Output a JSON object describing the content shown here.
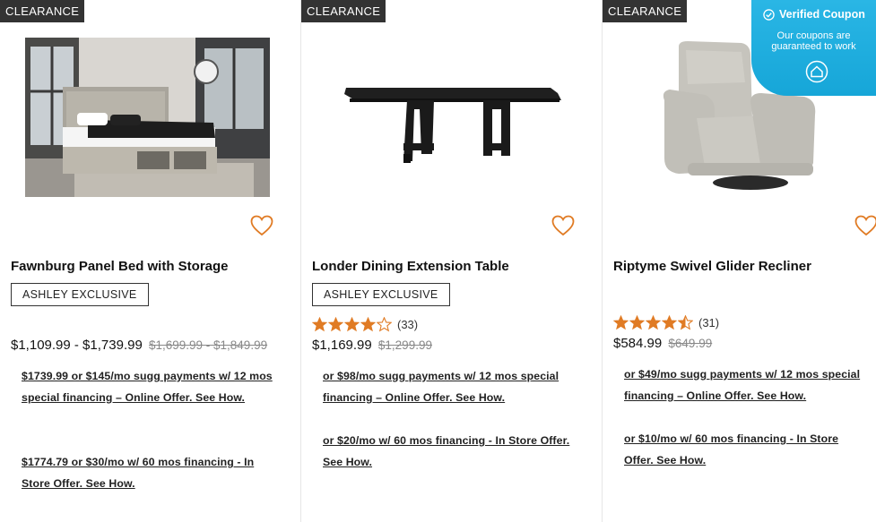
{
  "products": [
    {
      "badge": "CLEARANCE",
      "name": "Fawnburg Panel Bed with Storage",
      "exclusive": "ASHLEY EXCLUSIVE",
      "price_range": "$1,109.99 - $1,739.99",
      "was_price": "$1,699.99 - $1,849.99",
      "fin1": "$1739.99 or $145/mo sugg payments w/ 12 mos special financing – Online Offer. See How.",
      "fin2": "$1774.79 or $30/mo w/ 60 mos financing - In Store Offer. See How."
    },
    {
      "badge": "CLEARANCE",
      "name": "Londer Dining Extension Table",
      "exclusive": "ASHLEY EXCLUSIVE",
      "rating": 4,
      "rating_count": "(33)",
      "price": "$1,169.99",
      "was_price": "$1,299.99",
      "fin1": "or $98/mo sugg payments w/ 12 mos special financing – Online Offer. See How.",
      "fin2": "or $20/mo w/ 60 mos financing - In Store Offer. See How."
    },
    {
      "badge": "CLEARANCE",
      "name": "Riptyme Swivel Glider Recliner",
      "rating": 4.5,
      "rating_count": "(31)",
      "price": "$584.99",
      "was_price": "$649.99",
      "fin1": "or $49/mo sugg payments w/ 12 mos special financing – Online Offer. See How.",
      "fin2": "or $10/mo w/ 60 mos financing - In Store Offer. See How."
    }
  ],
  "coupon": {
    "title": "Verified Coupon",
    "subtitle": "Our coupons are guaranteed to work"
  },
  "colors": {
    "accent": "#e07b24",
    "badge": "#333333",
    "coupon": "#1aa9db"
  },
  "icons": {
    "heart": "heart-icon",
    "star": "star-icon",
    "check": "check-circle-icon",
    "home": "home-icon"
  }
}
